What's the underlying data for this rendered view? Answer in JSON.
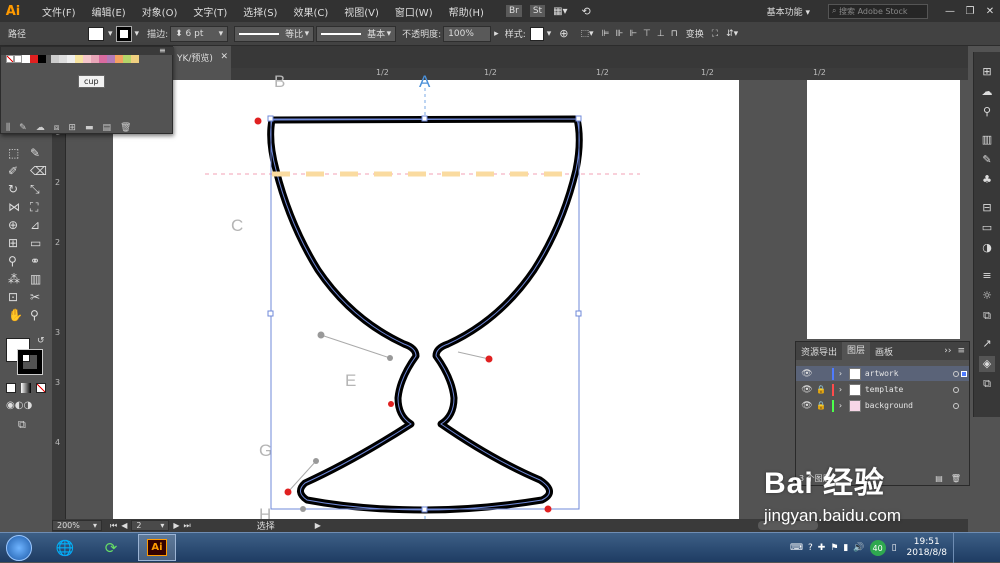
{
  "app": {
    "logo": "Ai",
    "accent": "#ff9a00"
  },
  "menu": [
    "文件(F)",
    "编辑(E)",
    "对象(O)",
    "文字(T)",
    "选择(S)",
    "效果(C)",
    "视图(V)",
    "窗口(W)",
    "帮助(H)"
  ],
  "menu_icons": [
    "Br",
    "St"
  ],
  "workspace": {
    "label": "基本功能",
    "search_placeholder": "搜索 Adobe Stock"
  },
  "control": {
    "object_type": "路径",
    "stroke_label": "描边:",
    "stroke_value": "6 pt",
    "profile_label": "等比",
    "brush_label": "基本",
    "opacity_label": "不透明度:",
    "opacity_value": "100%",
    "style_label": "样式:",
    "transform_label": "变换"
  },
  "swatch_panel": {
    "tooltip": "cup"
  },
  "document_tab": {
    "label": "YK/预览)"
  },
  "ruler": {
    "h_ticks": [
      "1/2",
      "1/2",
      "1/2",
      "1/2",
      "1/2"
    ],
    "v_ticks": [
      "1",
      "2",
      "2",
      "3",
      "3",
      "4"
    ]
  },
  "canvas_labels": [
    "B",
    "A",
    "C",
    "E",
    "G",
    "H"
  ],
  "layers_panel": {
    "tabs": [
      "资源导出",
      "图层",
      "画板"
    ],
    "active_tab": 1,
    "layers": [
      {
        "name": "artwork",
        "color": "#4f7bff",
        "selected": true
      },
      {
        "name": "template",
        "color": "#ff4b4b",
        "selected": false
      },
      {
        "name": "background",
        "color": "#4bff4b",
        "selected": false
      }
    ],
    "count": "3 个图层"
  },
  "status": {
    "zoom": "200%",
    "artboard_index": "2",
    "tool": "选择"
  },
  "watermark": {
    "brand": "Bai 经验",
    "url": "jingyan.baidu.com"
  },
  "taskbar": {
    "time": "19:51",
    "date": "2018/8/8",
    "badge": "40"
  }
}
